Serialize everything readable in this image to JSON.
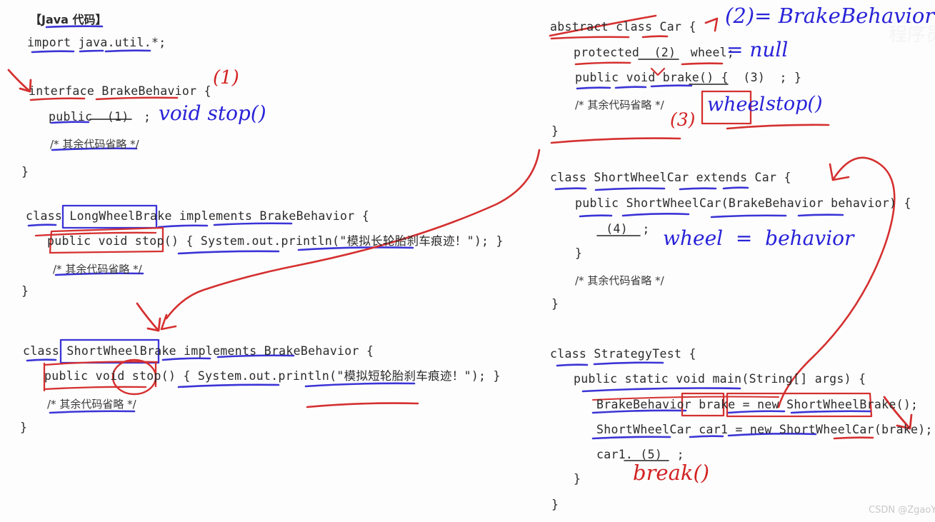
{
  "meta": {
    "watermark": "CSDN @ZgaoYi",
    "watermark_faint": "程序员",
    "colors": {
      "ink_blue": "#2822d8",
      "ink_red": "#d22222",
      "code_text": "#2b2b2b",
      "background": "#fdfdfd"
    }
  },
  "title": "【Java 代码】",
  "left_column": {
    "lines": [
      {
        "id": "import",
        "text": "import java.util.*;"
      },
      {
        "id": "iface-decl",
        "text": "interface BrakeBehavior {"
      },
      {
        "id": "iface-method",
        "text": "public  (1)  ;"
      },
      {
        "id": "iface-comment",
        "text": "/* 其余代码省略 */"
      },
      {
        "id": "iface-close",
        "text": "}"
      },
      {
        "id": "long-class-decl",
        "text": "class LongWheelBrake implements BrakeBehavior {"
      },
      {
        "id": "long-stop",
        "text": "public void stop() { System.out.println(\"模拟长轮胎刹车痕迹！\"); }"
      },
      {
        "id": "long-comment",
        "text": "/* 其余代码省略 */"
      },
      {
        "id": "long-close",
        "text": "}"
      },
      {
        "id": "short-class-decl",
        "text": "class ShortWheelBrake implements BrakeBehavior {"
      },
      {
        "id": "short-stop",
        "text": "public void stop() { System.out.println(\"模拟短轮胎刹车痕迹！\"); }"
      },
      {
        "id": "short-comment",
        "text": "/* 其余代码省略 */"
      },
      {
        "id": "short-close",
        "text": "}"
      }
    ]
  },
  "right_column": {
    "lines": [
      {
        "id": "car-decl",
        "text": "abstract class Car {"
      },
      {
        "id": "car-field",
        "text": "protected  (2)  wheel;"
      },
      {
        "id": "car-brake",
        "text": "public void brake() {  (3)  ; }"
      },
      {
        "id": "car-comment",
        "text": "/* 其余代码省略 */"
      },
      {
        "id": "car-close",
        "text": "}"
      },
      {
        "id": "swc-decl",
        "text": "class ShortWheelCar extends Car {"
      },
      {
        "id": "swc-ctor",
        "text": "public ShortWheelCar(BrakeBehavior behavior) {"
      },
      {
        "id": "swc-blank4",
        "text": " (4)  ;"
      },
      {
        "id": "swc-ctor-close",
        "text": "}"
      },
      {
        "id": "swc-comment",
        "text": "/* 其余代码省略 */"
      },
      {
        "id": "swc-close",
        "text": "}"
      },
      {
        "id": "test-decl",
        "text": "class StrategyTest {"
      },
      {
        "id": "test-main",
        "text": "public static void main(String[] args) {"
      },
      {
        "id": "test-brake",
        "text": "BrakeBehavior brake = new ShortWheelBrake();"
      },
      {
        "id": "test-car1",
        "text": "ShortWheelCar car1 = new ShortWheelCar(brake);"
      },
      {
        "id": "test-call",
        "text": "car1. (5)  ;"
      },
      {
        "id": "test-main-close",
        "text": "}"
      },
      {
        "id": "test-close",
        "text": "}"
      }
    ]
  },
  "annotations": [
    {
      "id": "ann-1-label",
      "text": "(1)",
      "color": "red"
    },
    {
      "id": "ann-1-answer",
      "text": "void stop()",
      "color": "blue"
    },
    {
      "id": "ann-2-answer",
      "text": "(2)= BrakeBehavior",
      "color": "blue"
    },
    {
      "id": "ann-2-null",
      "text": "= null",
      "color": "blue"
    },
    {
      "id": "ann-3-label",
      "text": "(3)",
      "color": "red"
    },
    {
      "id": "ann-3-wheel",
      "text": "wheel",
      "color": "blue"
    },
    {
      "id": "ann-3-stop",
      "text": ". stop()",
      "color": "blue"
    },
    {
      "id": "ann-4-answer",
      "text": "wheel  =  behavior",
      "color": "blue"
    },
    {
      "id": "ann-5-answer",
      "text": "break()",
      "color": "red"
    }
  ]
}
